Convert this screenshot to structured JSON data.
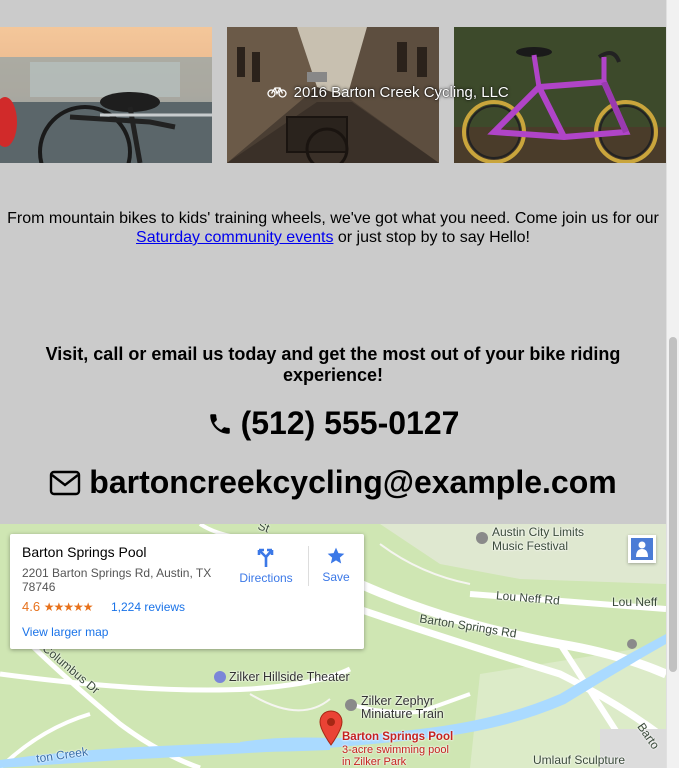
{
  "gallery": {
    "copyright": "2016 Barton Creek Cycling, LLC",
    "photos": [
      "city bike at railing",
      "street bike with basket",
      "purple road bike"
    ]
  },
  "intro": {
    "text_before": "From mountain bikes to kids' training wheels, we've got what you need. Come join us for our ",
    "link_text": "Saturday community events",
    "text_after": " or just stop by to say Hello!"
  },
  "contact": {
    "cta": "Visit, call or email us today and get the most out of your bike riding experience!",
    "phone": "(512) 555-0127",
    "email": "bartoncreekcycling@example.com"
  },
  "map": {
    "card": {
      "title": "Barton Springs Pool",
      "address": "2201 Barton Springs Rd, Austin, TX 78746",
      "rating": "4.6",
      "stars": "★★★★★",
      "reviews": "1,224 reviews",
      "larger_map": "View larger map",
      "directions": "Directions",
      "save": "Save"
    },
    "labels": {
      "festival_line1": "Austin City Limits",
      "festival_line2": "Music Festival",
      "lou_neff_1": "Lou Neff Rd",
      "lou_neff_2": "Lou Neff",
      "barton_springs_rd": "Barton Springs Rd",
      "columbus_dr": "Columbus Dr",
      "hillside_theater": "Zilker Hillside Theater",
      "zephyr_line1": "Zilker Zephyr",
      "zephyr_line2": "Miniature Train",
      "creek": "ton Creek",
      "umlauf": "Umlauf Sculpture",
      "barto": "Barto",
      "st_partial": "St"
    },
    "pin": {
      "title": "Barton Springs Pool",
      "subtitle": "3-acre swimming pool in Zilker Park"
    }
  },
  "colors": {
    "page_bg": "#cbcbcb",
    "link": "#0000ee",
    "map_green": "#cde8b0",
    "water": "#aadaff",
    "pin_red": "#ea4335"
  }
}
